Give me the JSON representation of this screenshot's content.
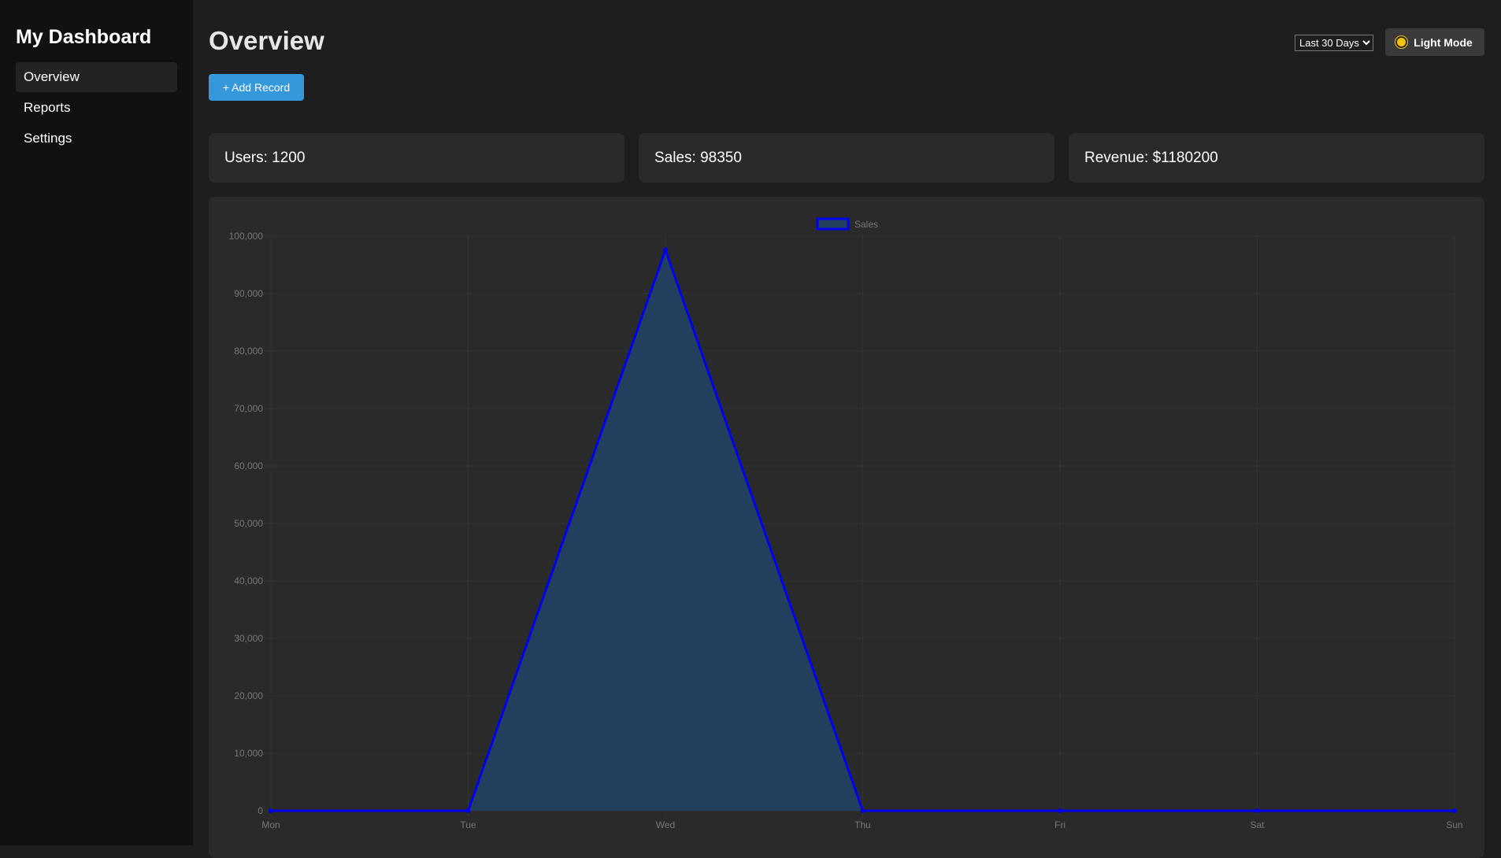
{
  "sidebar": {
    "title": "My Dashboard",
    "items": [
      {
        "label": "Overview",
        "active": true
      },
      {
        "label": "Reports",
        "active": false
      },
      {
        "label": "Settings",
        "active": false
      }
    ]
  },
  "header": {
    "title": "Overview",
    "add_button": "+ Add Record",
    "range_select": {
      "selected": "Last 30 Days"
    },
    "theme_toggle": {
      "label": "Light Mode",
      "icon": "sun-icon"
    }
  },
  "stats": [
    {
      "label": "Users: 1200"
    },
    {
      "label": "Sales: 98350"
    },
    {
      "label": "Revenue: $1180200"
    }
  ],
  "colors": {
    "accent": "#3498db",
    "series_line": "#0000ee",
    "series_fill": "#22405e",
    "sun": "#f2c40f"
  },
  "chart_data": {
    "type": "line",
    "categories": [
      "Mon",
      "Tue",
      "Wed",
      "Thu",
      "Fri",
      "Sat",
      "Sun"
    ],
    "series": [
      {
        "name": "Sales",
        "values": [
          0,
          0,
          97600,
          0,
          0,
          0,
          0
        ],
        "fill": true
      }
    ],
    "ylim": [
      0,
      100000
    ],
    "yticks": [
      0,
      10000,
      20000,
      30000,
      40000,
      50000,
      60000,
      70000,
      80000,
      90000,
      100000
    ],
    "ytick_labels": [
      "0",
      "10,000",
      "20,000",
      "30,000",
      "40,000",
      "50,000",
      "60,000",
      "70,000",
      "80,000",
      "90,000",
      "100,000"
    ],
    "grid": true,
    "legend": "top-center"
  }
}
